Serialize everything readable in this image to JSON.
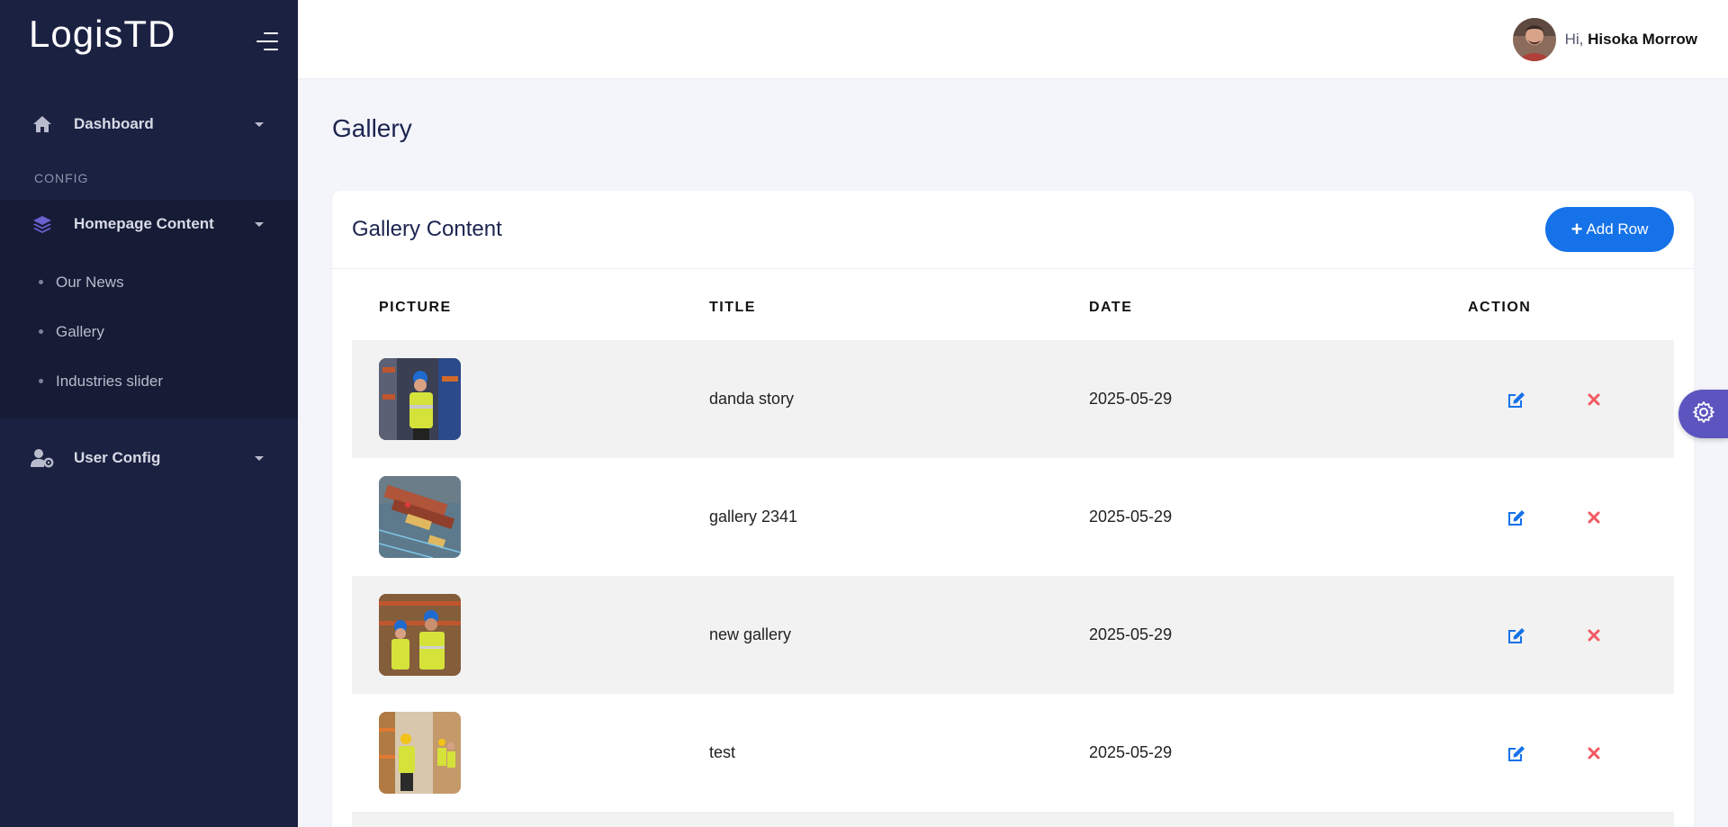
{
  "brand": {
    "name": "LogisTD"
  },
  "sidebar": {
    "items": [
      {
        "label": "Dashboard",
        "icon": "home-icon"
      }
    ],
    "section_label": "CONFIG",
    "homepage": {
      "label": "Homepage Content",
      "icon": "layers-icon",
      "accent": "#6861ce",
      "sub_items": [
        {
          "label": "Our News"
        },
        {
          "label": "Gallery"
        },
        {
          "label": "Industries slider"
        }
      ]
    },
    "user_config": {
      "label": "User Config",
      "icon": "user-cog-icon"
    }
  },
  "topbar": {
    "greeting": "Hi,",
    "user_name": "Hisoka Morrow"
  },
  "page": {
    "title": "Gallery"
  },
  "card": {
    "title": "Gallery Content",
    "add_button": {
      "icon": "+",
      "label": "Add Row"
    },
    "columns": [
      "PICTURE",
      "TITLE",
      "DATE",
      "ACTION"
    ],
    "rows": [
      {
        "title": "danda story",
        "date": "2025-05-29"
      },
      {
        "title": "gallery 2341",
        "date": "2025-05-29"
      },
      {
        "title": "new gallery",
        "date": "2025-05-29"
      },
      {
        "title": "test",
        "date": "2025-05-29"
      }
    ]
  },
  "colors": {
    "sidebar_bg": "#1b2141",
    "primary": "#1572e8",
    "danger": "#f25961",
    "fab": "#5c55bf"
  }
}
